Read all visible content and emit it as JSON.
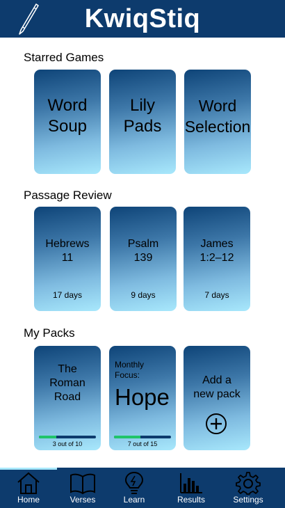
{
  "app": {
    "title": "KwiqStiq"
  },
  "starred": {
    "title": "Starred Games",
    "games": [
      {
        "line1": "Word",
        "line2": "Soup"
      },
      {
        "line1": "Lily",
        "line2": "Pads"
      },
      {
        "line1": "Word",
        "line2": "Selection"
      }
    ]
  },
  "review": {
    "title": "Passage Review",
    "passages": [
      {
        "line1": "Hebrews",
        "line2": "11",
        "days": "17 days"
      },
      {
        "line1": "Psalm",
        "line2": "139",
        "days": "9 days"
      },
      {
        "line1": "James",
        "line2": "1:2–12",
        "days": "7 days"
      }
    ]
  },
  "packs": {
    "title": "My Packs",
    "items": [
      {
        "line1": "The",
        "line2": "Roman",
        "line3": "Road",
        "progress": 0.3,
        "progress_text": "3 out of 10"
      },
      {
        "label_line1": "Monthly",
        "label_line2": "Focus:",
        "word": "Hope",
        "progress": 0.4667,
        "progress_text": "7 out of 15"
      }
    ],
    "add": {
      "line1": "Add a",
      "line2": "new pack"
    }
  },
  "tabs": [
    {
      "label": "Home",
      "icon": "home-icon",
      "active": true
    },
    {
      "label": "Verses",
      "icon": "book-icon"
    },
    {
      "label": "Learn",
      "icon": "lightbulb-icon"
    },
    {
      "label": "Results",
      "icon": "bar-chart-icon"
    },
    {
      "label": "Settings",
      "icon": "gear-icon"
    }
  ],
  "colors": {
    "header": "#0d3b6d",
    "progress": "#20c46a",
    "card_light": "#a8e8fc"
  }
}
